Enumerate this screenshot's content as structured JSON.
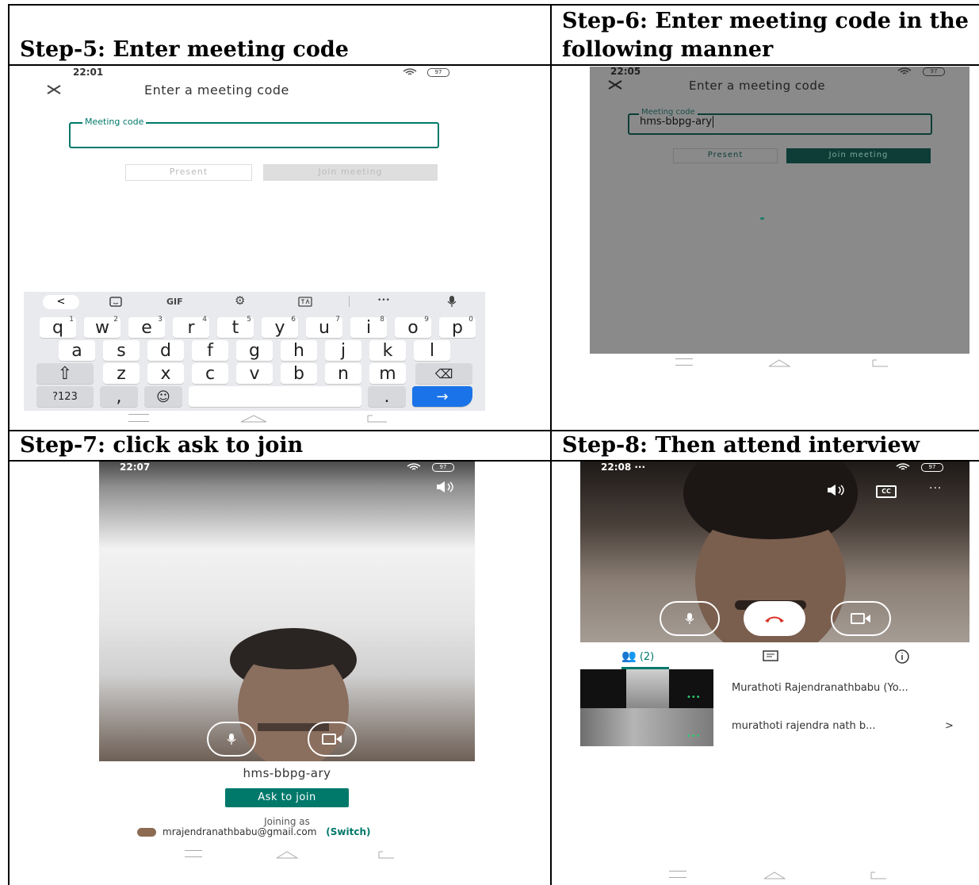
{
  "headings": {
    "step5": "Step-5: Enter meeting code",
    "step6_line1": "Step-6:  Enter  meeting  code  in  the",
    "step6_line2": "following manner",
    "step7": "Step-7: click ask to join",
    "step8": "Step-8: Then attend interview"
  },
  "step5": {
    "time": "22:01",
    "battery": "97",
    "title": "Enter a meeting code",
    "field_label": "Meeting code",
    "present_label": "Present",
    "join_label": "Join meeting",
    "keyboard": {
      "toolbar": {
        "gif": "GIF",
        "more": "•••"
      },
      "row1": [
        {
          "k": "q",
          "n": "1"
        },
        {
          "k": "w",
          "n": "2"
        },
        {
          "k": "e",
          "n": "3"
        },
        {
          "k": "r",
          "n": "4"
        },
        {
          "k": "t",
          "n": "5"
        },
        {
          "k": "y",
          "n": "6"
        },
        {
          "k": "u",
          "n": "7"
        },
        {
          "k": "i",
          "n": "8"
        },
        {
          "k": "o",
          "n": "9"
        },
        {
          "k": "p",
          "n": "0"
        }
      ],
      "row2": [
        "a",
        "s",
        "d",
        "f",
        "g",
        "h",
        "j",
        "k",
        "l"
      ],
      "row3": [
        "z",
        "x",
        "c",
        "v",
        "b",
        "n",
        "m"
      ],
      "numbers_key": "?123",
      "comma_key": ",",
      "period_key": "."
    }
  },
  "step6": {
    "time": "22:05",
    "battery": "97",
    "title": "Enter a meeting code",
    "field_label": "Meeting code",
    "field_value": "hms-bbpg-ary",
    "present_label": "Present",
    "join_label": "Join meeting"
  },
  "step7": {
    "time": "22:07",
    "battery": "97",
    "meeting_code": "hms-bbpg-ary",
    "ask_button": "Ask to join",
    "joining_as": "Joining as",
    "email": "mrajendranathbabu@gmail.com",
    "switch_label": "(Switch)"
  },
  "step8": {
    "time": "22:08 ···",
    "battery": "97",
    "cc_label": "CC",
    "people_count": "(2)",
    "participants": [
      {
        "name": "Murathoti Rajendranathbabu (Yo..."
      },
      {
        "name": "murathoti rajendra nath b..."
      }
    ],
    "dots": "•••",
    "chevron": ">"
  },
  "colors": {
    "meet_green": "#00796b",
    "hangup_red": "#d93025",
    "keyboard_bg": "#e8eaed",
    "enter_blue": "#1a73e8"
  }
}
